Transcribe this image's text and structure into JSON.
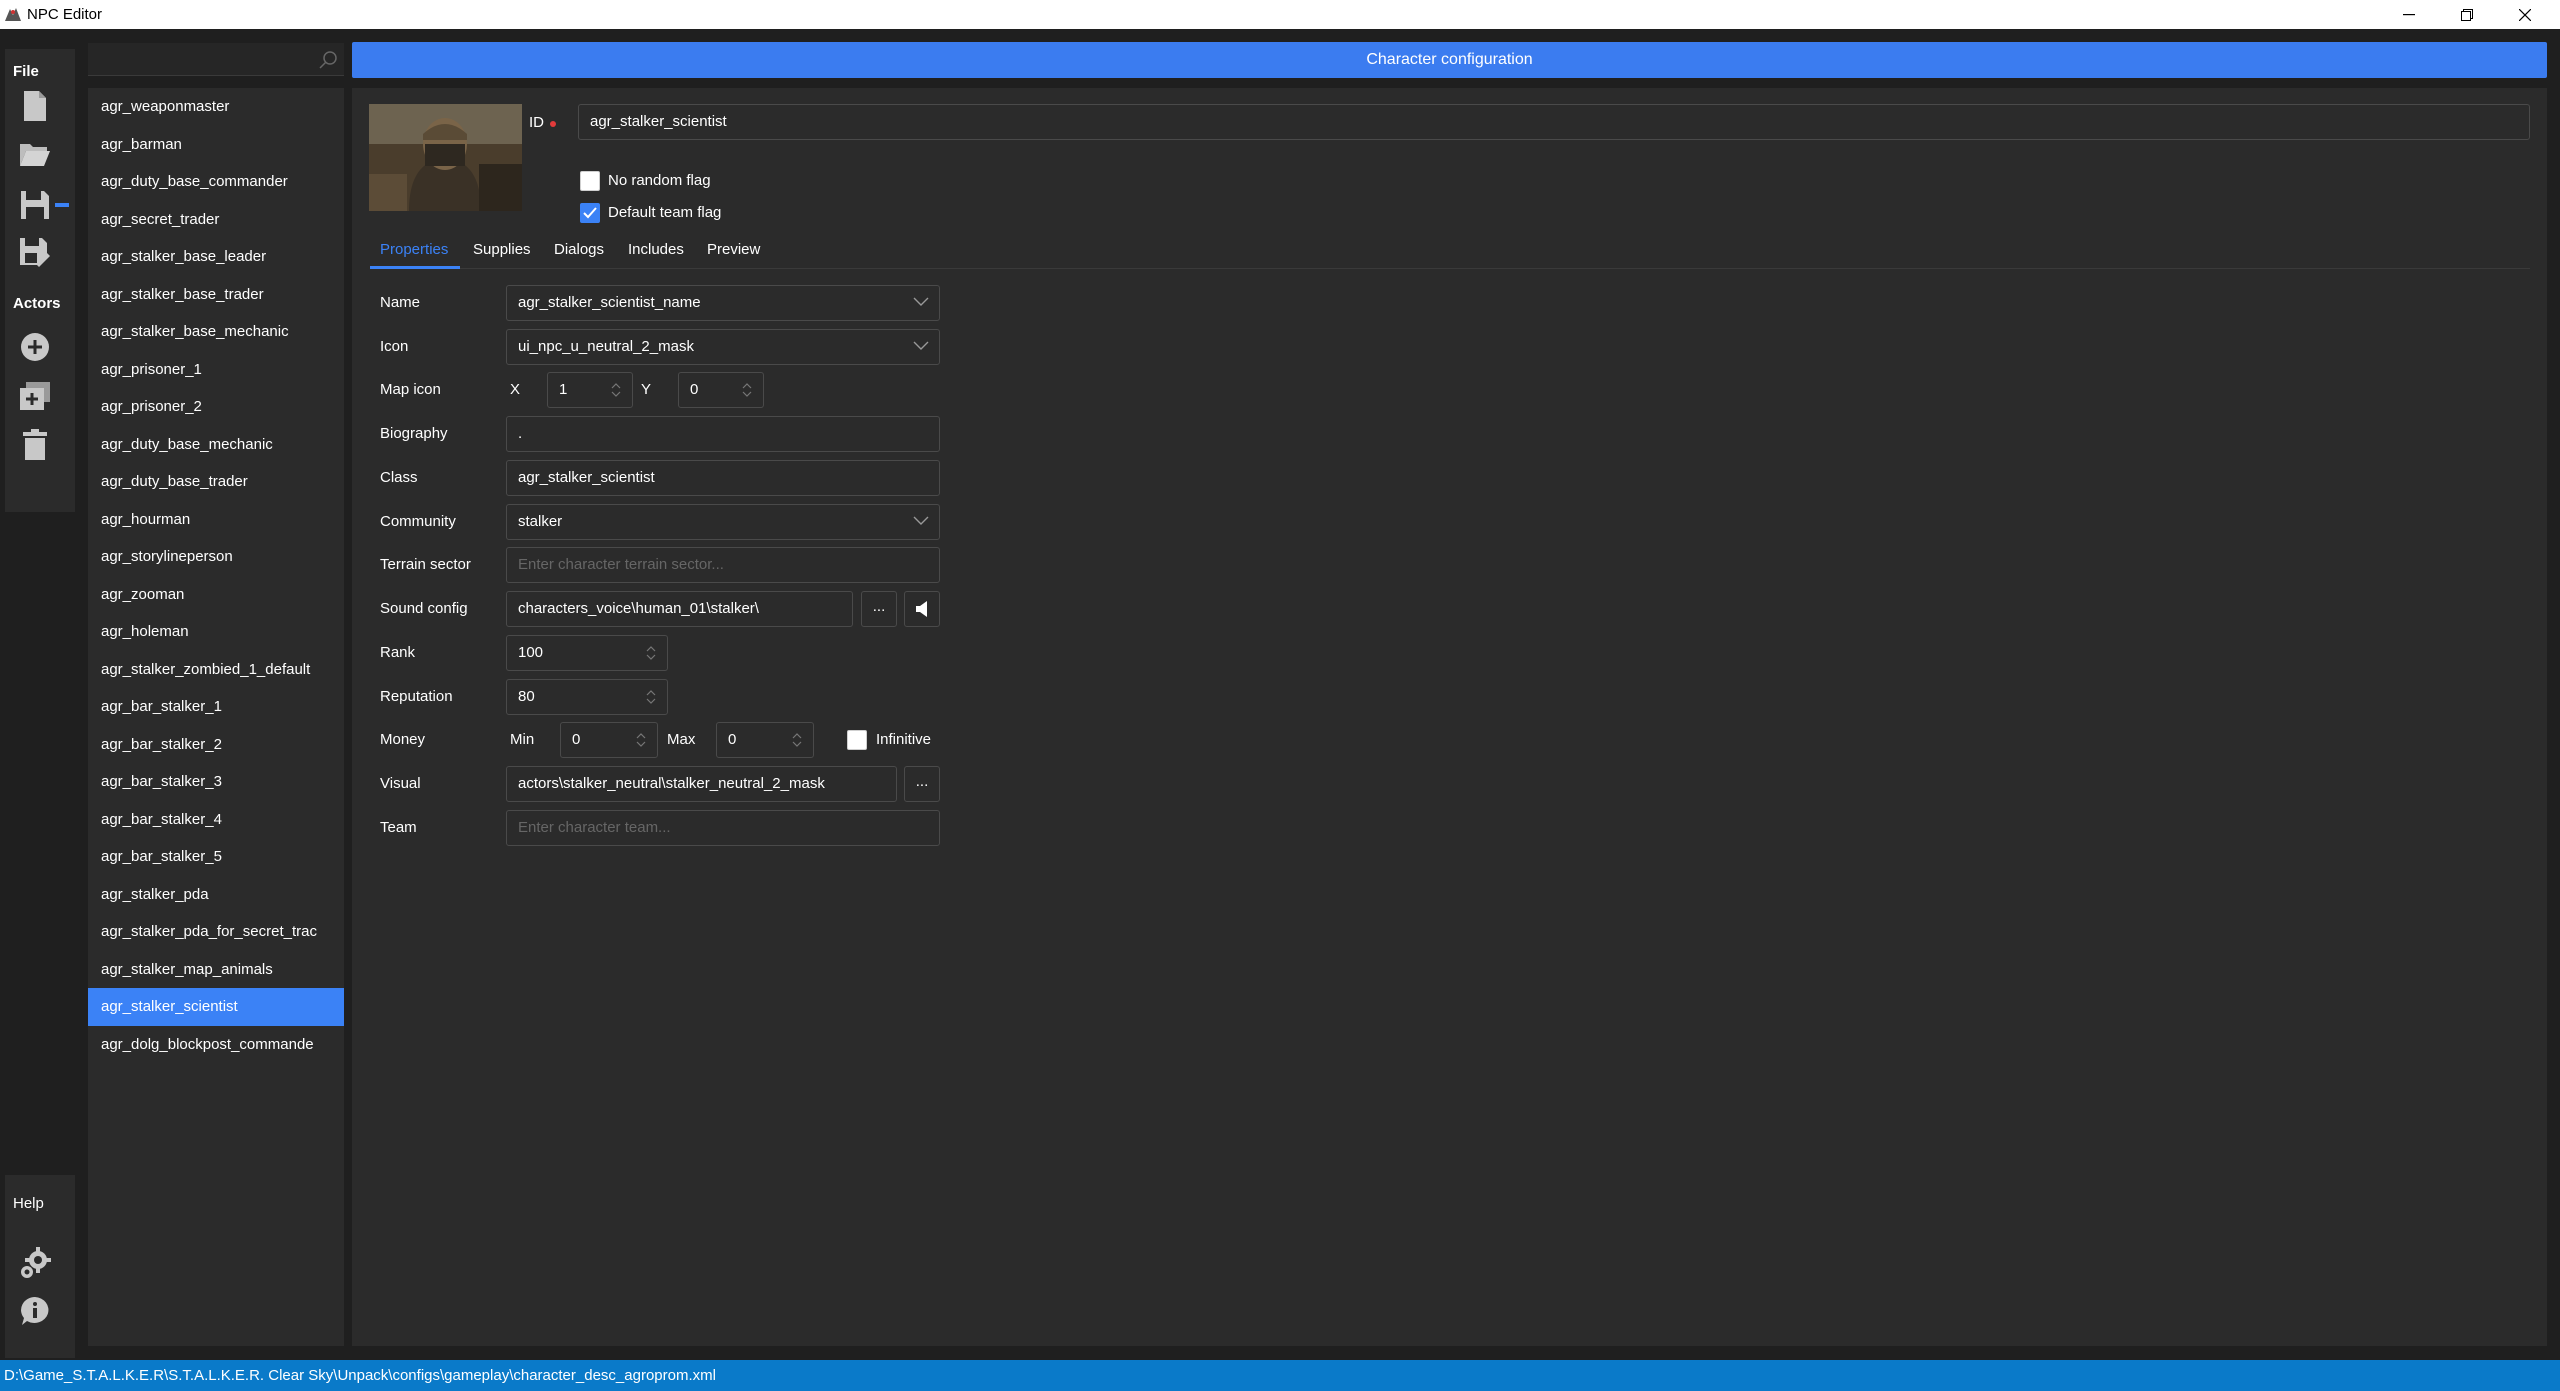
{
  "window": {
    "title": "NPC Editor"
  },
  "rail": {
    "file_label": "File",
    "actors_label": "Actors",
    "help_label": "Help"
  },
  "search": {
    "value": "",
    "placeholder": ""
  },
  "actors": [
    "agr_weaponmaster",
    "agr_barman",
    "agr_duty_base_commander",
    "agr_secret_trader",
    "agr_stalker_base_leader",
    "agr_stalker_base_trader",
    "agr_stalker_base_mechanic",
    "agr_prisoner_1",
    "agr_prisoner_2",
    "agr_duty_base_mechanic",
    "agr_duty_base_trader",
    "agr_hourman",
    "agr_storylineperson",
    "agr_zooman",
    "agr_holeman",
    "agr_stalker_zombied_1_default",
    "agr_bar_stalker_1",
    "agr_bar_stalker_2",
    "agr_bar_stalker_3",
    "agr_bar_stalker_4",
    "agr_bar_stalker_5",
    "agr_stalker_pda",
    "agr_stalker_pda_for_secret_trac",
    "agr_stalker_map_animals",
    "agr_stalker_scientist",
    "agr_dolg_blockpost_commande"
  ],
  "selected_actor": "agr_stalker_scientist",
  "header": {
    "title": "Character configuration"
  },
  "character": {
    "id_label": "ID",
    "id_value": "agr_stalker_scientist",
    "no_random_flag_label": "No random flag",
    "no_random_flag": false,
    "default_team_flag_label": "Default team flag",
    "default_team_flag": true
  },
  "tabs": [
    "Properties",
    "Supplies",
    "Dialogs",
    "Includes",
    "Preview"
  ],
  "active_tab": "Properties",
  "properties": {
    "name_label": "Name",
    "name_value": "agr_stalker_scientist_name",
    "icon_label": "Icon",
    "icon_value": "ui_npc_u_neutral_2_mask",
    "map_icon_label": "Map icon",
    "map_icon_x_label": "X",
    "map_icon_x": "1",
    "map_icon_y_label": "Y",
    "map_icon_y": "0",
    "biography_label": "Biography",
    "biography_value": ".",
    "class_label": "Class",
    "class_value": "agr_stalker_scientist",
    "community_label": "Community",
    "community_value": "stalker",
    "terrain_sector_label": "Terrain sector",
    "terrain_sector_placeholder": "Enter character terrain sector...",
    "sound_config_label": "Sound config",
    "sound_config_value": "characters_voice\\human_01\\stalker\\",
    "browse_label": "...",
    "rank_label": "Rank",
    "rank_value": "100",
    "reputation_label": "Reputation",
    "reputation_value": "80",
    "money_label": "Money",
    "money_min_label": "Min",
    "money_min": "0",
    "money_max_label": "Max",
    "money_max": "0",
    "infinitive_label": "Infinitive",
    "infinitive": false,
    "visual_label": "Visual",
    "visual_value": "actors\\stalker_neutral\\stalker_neutral_2_mask",
    "team_label": "Team",
    "team_placeholder": "Enter character team..."
  },
  "status": {
    "path": "D:\\Game_S.T.A.L.K.E.R\\S.T.A.L.K.E.R. Clear Sky\\Unpack\\configs\\gameplay\\character_desc_agroprom.xml"
  }
}
